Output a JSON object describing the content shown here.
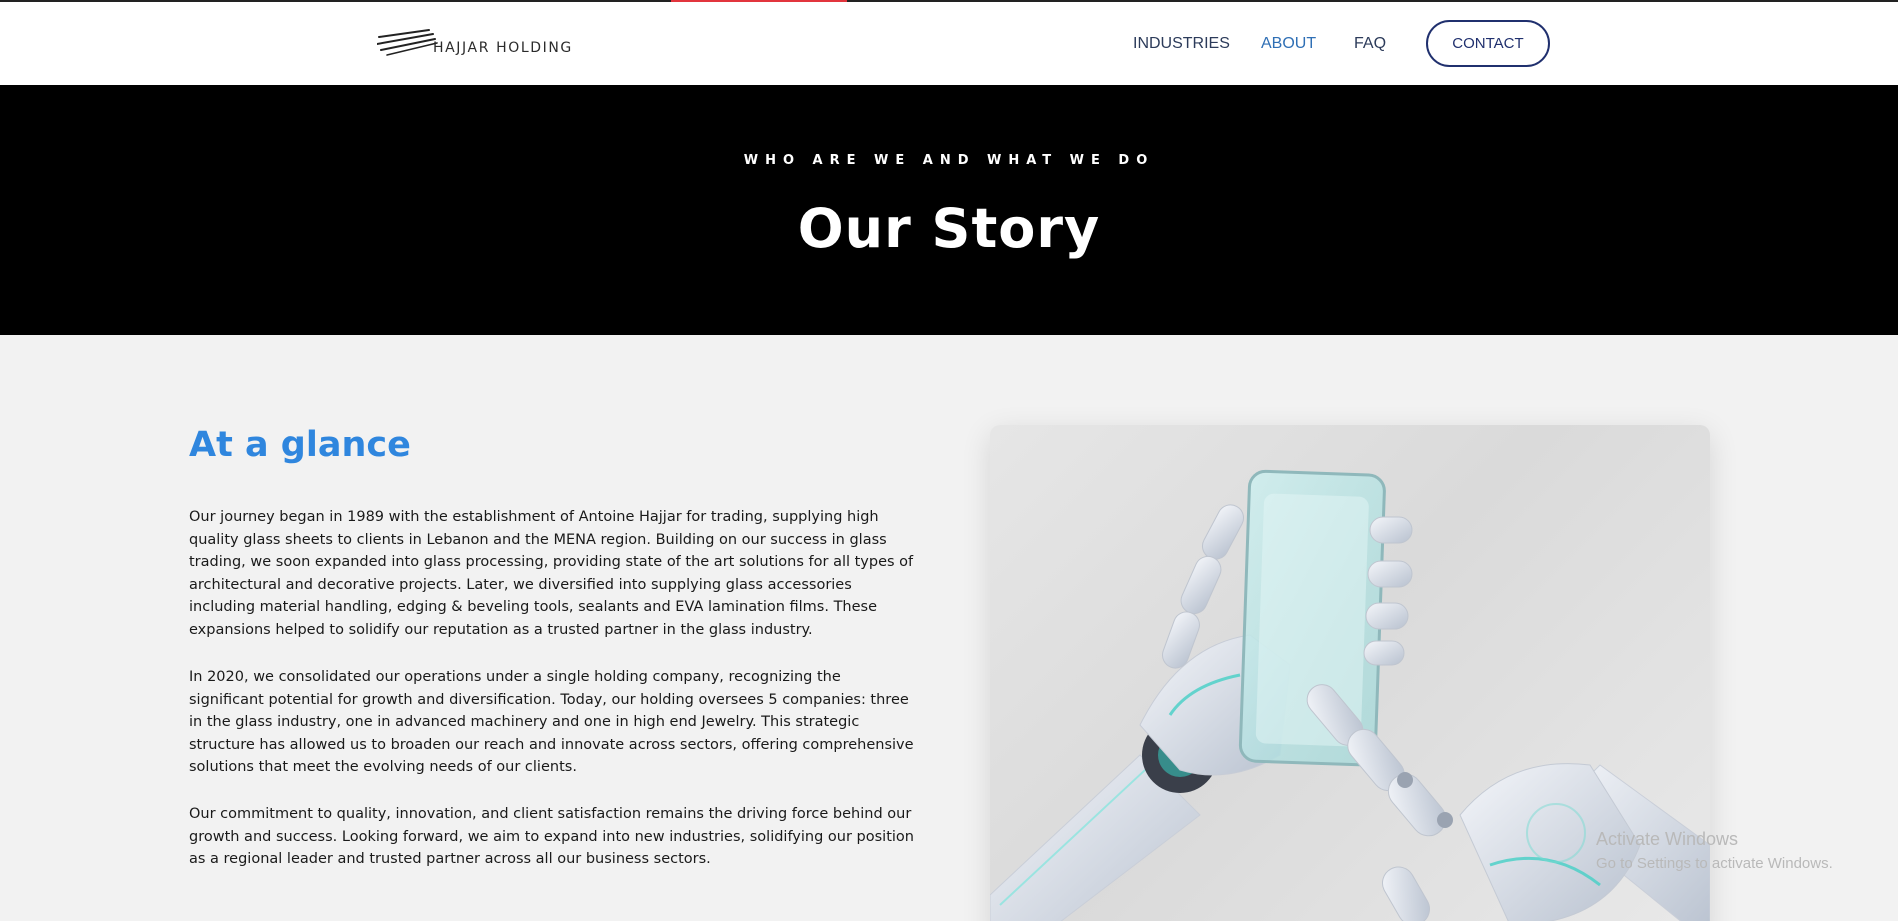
{
  "header": {
    "logo_text": "HAJJAR HOLDING",
    "nav": {
      "industries": "INDUSTRIES",
      "about": "ABOUT",
      "faq": "FAQ",
      "contact": "CONTACT"
    }
  },
  "hero": {
    "kicker": "WHO ARE WE AND WHAT WE DO",
    "title": "Our Story"
  },
  "about": {
    "title": "At a glance",
    "paragraphs": [
      "Our journey began in 1989 with the establishment of Antoine Hajjar for trading, supplying high quality glass sheets to clients in Lebanon and the MENA region. Building on our success in glass trading, we soon expanded into glass processing, providing state of the art solutions for all types of architectural and decorative projects. Later, we diversified into supplying glass accessories including material handling, edging & beveling tools, sealants and EVA lamination films. These expansions helped to solidify our reputation as a trusted partner in the glass industry.",
      "In 2020, we consolidated our operations under a single holding company, recognizing the significant potential for growth and diversification. Today, our holding oversees 5 companies: three in the glass industry, one in advanced machinery and one in high end Jewelry. This strategic structure has allowed us to broaden our reach and innovate across sectors, offering comprehensive solutions that meet the evolving needs of our clients.",
      "Our commitment to quality, innovation, and client satisfaction remains the driving force behind our growth and success. Looking forward, we aim to expand into new industries, solidifying our position as a regional leader and trusted partner across all our business sectors."
    ]
  },
  "overlay": {
    "activate_title": "Activate Windows",
    "activate_sub": "Go to Settings to activate Windows."
  },
  "colors": {
    "accent_blue": "#2f86de",
    "nav_active": "#2f6fb5",
    "contact_border": "#20306e",
    "hero_bg": "#000000",
    "top_accent": "#e2353d"
  },
  "icons": {
    "logo": "hajjar-logo-mark",
    "hero_image": "robot-hands-smartphone-image"
  }
}
